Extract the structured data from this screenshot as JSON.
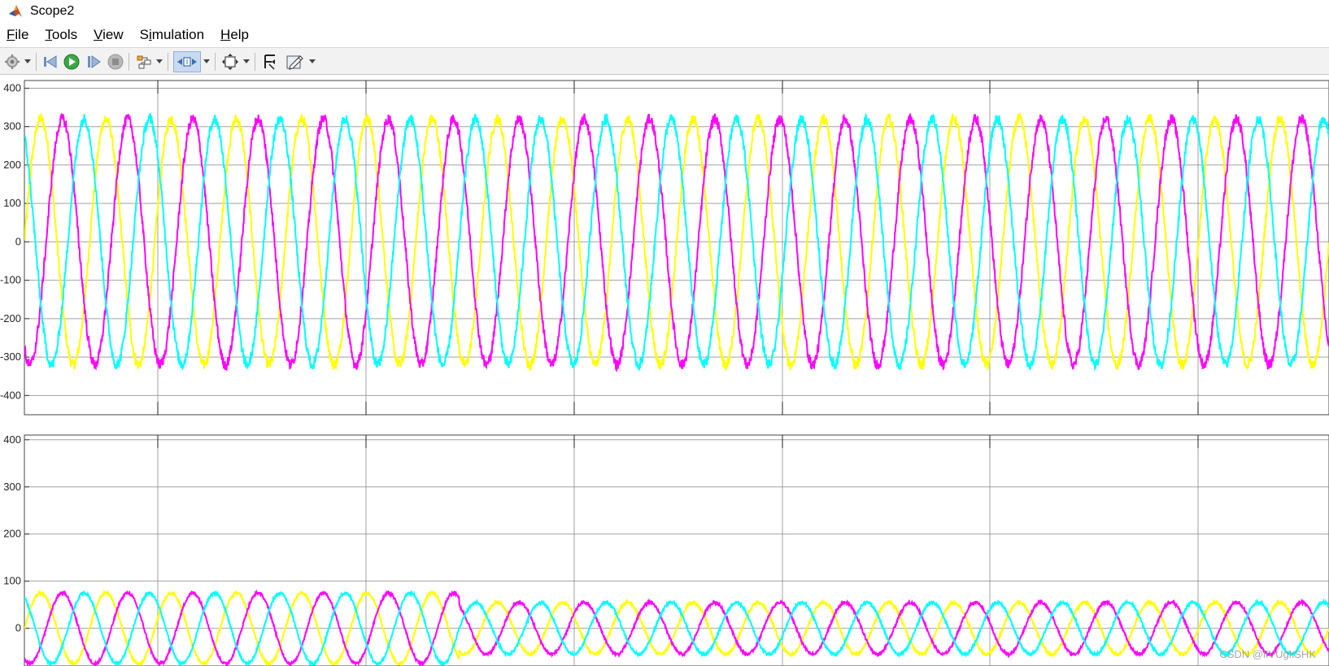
{
  "window": {
    "title": "Scope2"
  },
  "menu": [
    {
      "label": "File",
      "accel": "F"
    },
    {
      "label": "Tools",
      "accel": "T"
    },
    {
      "label": "View",
      "accel": "V"
    },
    {
      "label": "Simulation",
      "accel": "i"
    },
    {
      "label": "Help",
      "accel": "H"
    }
  ],
  "toolbar": {
    "icons": [
      "gear-icon",
      "step-back-icon",
      "run-icon",
      "step-forward-icon",
      "stop-icon",
      "highlight-block-icon",
      "zoom-icon",
      "fit-to-view-icon",
      "cursor-measurement-icon",
      "style-icon"
    ]
  },
  "colors": {
    "yellow": "#ffff00",
    "magenta": "#ff00ff",
    "cyan": "#00ffff",
    "grid": "#8a8a8a",
    "background": "#ffffff"
  },
  "chart_data": [
    {
      "type": "line",
      "ylim": [
        -450,
        420
      ],
      "yticks": [
        400,
        300,
        200,
        100,
        0,
        -100,
        -200,
        -300,
        -400
      ],
      "x_divisions": 6,
      "cycles": 20,
      "series": [
        {
          "color": "yellow",
          "amplitude": 320,
          "phase_deg": 0
        },
        {
          "color": "magenta",
          "amplitude": 320,
          "phase_deg": -120
        },
        {
          "color": "cyan",
          "amplitude": 320,
          "phase_deg": 120
        }
      ]
    },
    {
      "type": "line",
      "ylim": [
        -80,
        410
      ],
      "yticks": [
        400,
        300,
        200,
        100,
        0
      ],
      "x_divisions": 6,
      "cycles": 20,
      "amplitude_by_segment": [
        75,
        75,
        55,
        55,
        55,
        55
      ],
      "series": [
        {
          "color": "yellow",
          "phase_deg": 0
        },
        {
          "color": "magenta",
          "phase_deg": -120
        },
        {
          "color": "cyan",
          "phase_deg": 120
        }
      ]
    }
  ],
  "watermark": "CSDN @lIVUgkSHK"
}
